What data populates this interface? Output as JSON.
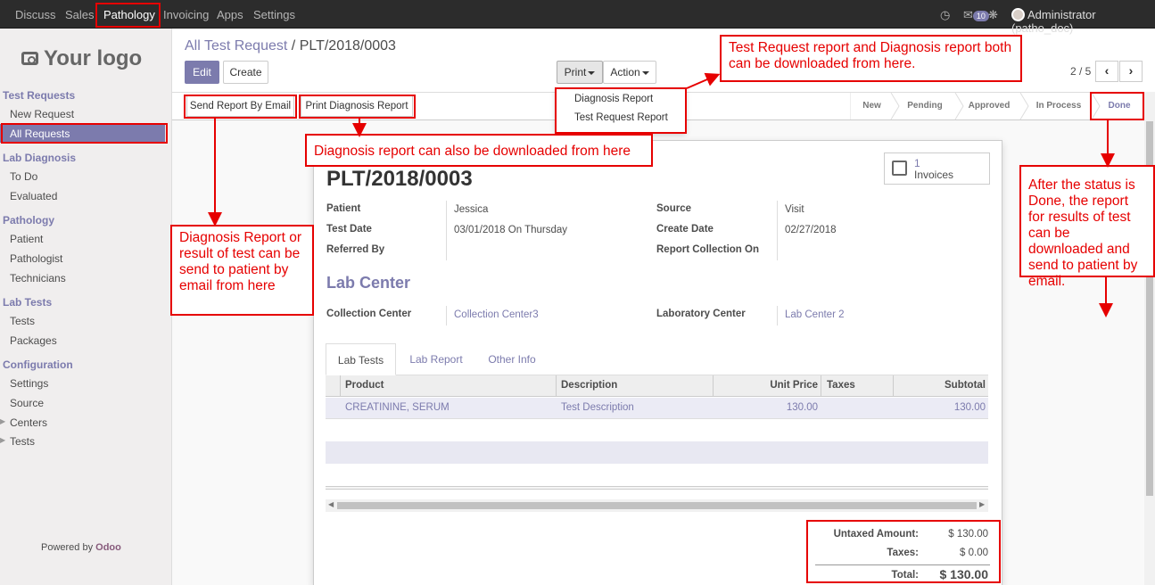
{
  "topbar": {
    "menu": [
      "Discuss",
      "Sales",
      "Pathology",
      "Invoicing",
      "Apps",
      "Settings"
    ],
    "active_menu": "Pathology",
    "badge": "10",
    "user": "Administrator (patho_doc)"
  },
  "sidebar": {
    "logo": "Your logo",
    "sections": [
      {
        "title": "Test Requests",
        "items": [
          "New Request",
          "All Requests"
        ]
      },
      {
        "title": "Lab Diagnosis",
        "items": [
          "To Do",
          "Evaluated"
        ]
      },
      {
        "title": "Pathology",
        "items": [
          "Patient",
          "Pathologist",
          "Technicians"
        ]
      },
      {
        "title": "Lab Tests",
        "items": [
          "Tests",
          "Packages"
        ]
      },
      {
        "title": "Configuration",
        "items": [
          "Settings",
          "Source",
          "Centers",
          "Tests"
        ]
      }
    ],
    "powered_prefix": "Powered by ",
    "powered_brand": "Odoo"
  },
  "control": {
    "breadcrumb_parent": "All Test Request",
    "breadcrumb_sep": "/",
    "breadcrumb_current": "PLT/2018/0003",
    "edit": "Edit",
    "create": "Create",
    "print": "Print",
    "action": "Action",
    "pager": "2 / 5"
  },
  "print_menu": [
    "Diagnosis Report",
    "Test Request Report"
  ],
  "header": {
    "send_email": "Send Report By Email",
    "print_diagnosis": "Print Diagnosis Report",
    "stages": [
      "New",
      "Pending",
      "Approved",
      "In Process",
      "Done"
    ],
    "current_stage": "Done"
  },
  "form": {
    "title": "PLT/2018/0003",
    "invoices_count": "1",
    "invoices_label": "Invoices",
    "patient_label": "Patient",
    "patient": "Jessica",
    "test_date_label": "Test Date",
    "test_date": "03/01/2018 On Thursday",
    "referred_by_label": "Referred By",
    "source_label": "Source",
    "source": "Visit",
    "create_date_label": "Create Date",
    "create_date": "02/27/2018",
    "report_collection_label": "Report Collection On",
    "lab_center_title": "Lab Center",
    "collection_center_label": "Collection Center",
    "collection_center": "Collection Center3",
    "laboratory_center_label": "Laboratory Center",
    "laboratory_center": "Lab Center 2",
    "tabs": [
      "Lab Tests",
      "Lab Report",
      "Other Info"
    ],
    "columns": [
      "Product",
      "Description",
      "Unit Price",
      "Taxes",
      "Subtotal"
    ],
    "rows": [
      {
        "product": "CREATININE, SERUM",
        "description": "Test Description",
        "unit_price": "130.00",
        "taxes": "",
        "subtotal": "130.00"
      }
    ],
    "untaxed_label": "Untaxed Amount:",
    "untaxed": "$ 130.00",
    "taxes_label": "Taxes:",
    "taxes": "$ 0.00",
    "total_label": "Total:",
    "total": "$ 130.00"
  },
  "annotations": {
    "print_note": "Test Request report and Diagnosis report both can be downloaded from here.",
    "diag_note": "Diagnosis report can also be downloaded from here",
    "email_note": "Diagnosis Report or result of test can be send to patient by email from here",
    "done_note": "After the status is Done, the report for results of test can be downloaded and send to patient by email."
  },
  "colors": {
    "accent": "#7c7bad",
    "annotation": "#e60000",
    "topbar": "#2c2c2c"
  }
}
